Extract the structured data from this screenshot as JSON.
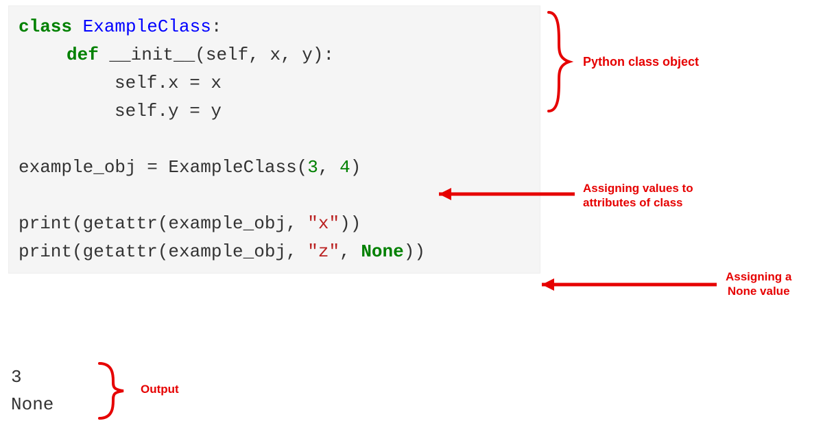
{
  "code": {
    "line1_kw": "class",
    "line1_name": " ExampleClass",
    "line1_colon": ":",
    "line2_kw": "def",
    "line2_method": " __init__",
    "line2_params": "(self, x, y):",
    "line3_text": "self.x = x",
    "line4_text": "self.y = y",
    "line6_var": "example_obj = ExampleClass(",
    "line6_num1": "3",
    "line6_comma": ", ",
    "line6_num2": "4",
    "line6_close": ")",
    "line8_call": "print(getattr(example_obj, ",
    "line8_str": "\"x\"",
    "line8_end": "))",
    "line9_call": "print(getattr(example_obj, ",
    "line9_str": "\"z\"",
    "line9_comma": ", ",
    "line9_none": "None",
    "line9_end": "))"
  },
  "output": {
    "line1": "3",
    "line2": "None"
  },
  "annotations": {
    "a1": "Python class object",
    "a2_l1": "Assigning values to",
    "a2_l2": "attributes of class",
    "a3_l1": "Assigning a",
    "a3_l2": "None value",
    "a4": "Output"
  }
}
